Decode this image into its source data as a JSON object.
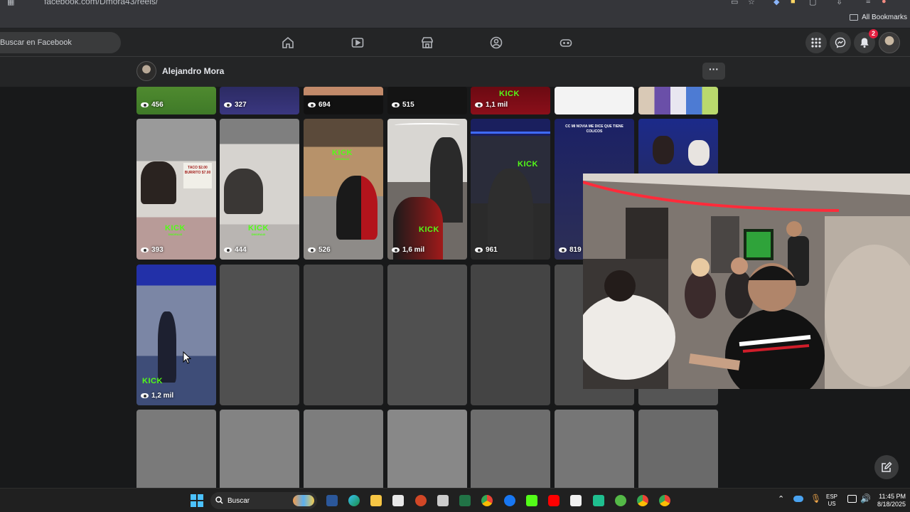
{
  "browser": {
    "url": "facebook.com/Dmora43/reels/",
    "bookmarks_label": "All Bookmarks"
  },
  "header": {
    "search_placeholder": "Buscar en Facebook",
    "notification_count": "2"
  },
  "profile": {
    "name": "Alejandro Mora",
    "more_label": "···"
  },
  "kick_label": "KICK",
  "kick_sub": "DMORA43",
  "grid": {
    "row1_views": [
      "456",
      "327",
      "694",
      "515",
      "1,1 mil",
      "",
      ""
    ],
    "row2_views": [
      "393",
      "444",
      "526",
      "1,6 mil",
      "961",
      "819",
      ""
    ],
    "row2_captions": [
      "TACO $2.00 BURRITO $7.00",
      "CC MI NOVIA ME DICE QUE TIENE COLICOS"
    ],
    "row3_views": [
      "1,2 mil"
    ]
  },
  "taskbar": {
    "search_label": "Buscar",
    "lang_top": "ESP",
    "lang_bottom": "US",
    "time": "11:45 PM",
    "date": "8/18/2025"
  },
  "colors": {
    "page_bg": "#18191a",
    "header_bg": "#242526",
    "kick_green": "#53fc18",
    "badge_red": "#e41e3f"
  }
}
